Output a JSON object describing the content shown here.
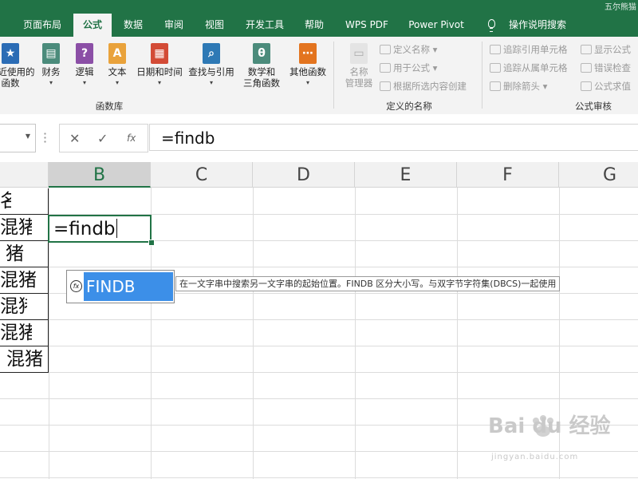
{
  "tabs": [
    "页面布局",
    "公式",
    "数据",
    "审阅",
    "视图",
    "开发工具",
    "帮助",
    "WPS PDF",
    "Power Pivot",
    "操作说明搜索"
  ],
  "title_fragment": "五尔熊猫",
  "ribbon": {
    "function_library": {
      "label": "函数库",
      "buttons": [
        {
          "label": "最近使用的\n函数",
          "icon": "star-icon",
          "color": "#2b6cb5"
        },
        {
          "label": "财务",
          "icon": "coins-icon",
          "color": "#4b8b7b"
        },
        {
          "label": "逻辑",
          "icon": "question-icon",
          "color": "#8b4fa6"
        },
        {
          "label": "文本",
          "icon": "text-a-icon",
          "color": "#e9a23b"
        },
        {
          "label": "日期和时间",
          "icon": "calendar-icon",
          "color": "#d34b36"
        },
        {
          "label": "查找与引用",
          "icon": "magnifier-icon",
          "color": "#2e79b5"
        },
        {
          "label": "数学和\n三角函数",
          "icon": "theta-icon",
          "color": "#4b8b7b"
        },
        {
          "label": "其他函数",
          "icon": "more-icon",
          "color": "#e3741f"
        }
      ]
    },
    "defined_names": {
      "label": "定义的名称",
      "name_manager": "名称\n管理器",
      "items": [
        "定义名称",
        "用于公式",
        "根据所选内容创建"
      ]
    },
    "formula_auditing": {
      "label": "公式审核",
      "items_left": [
        "追踪引用单元格",
        "追踪从属单元格",
        "删除箭头"
      ],
      "items_right": [
        "显示公式",
        "错误检查",
        "公式求值"
      ]
    }
  },
  "formula_bar": {
    "cancel": "✕",
    "enter": "✓",
    "fx": "fx",
    "content": "=findb"
  },
  "columns": [
    "B",
    "C",
    "D",
    "E",
    "F",
    "G"
  ],
  "column_a_cells": [
    "名",
    "混猪",
    "猪",
    "混猪",
    "混猪",
    "混猪",
    "混猪"
  ],
  "active_cell": {
    "text": "=findb"
  },
  "autocomplete": {
    "icon": "fx",
    "item": "FINDB",
    "tooltip": "在一文字串中搜索另一文字串的起始位置。FINDB 区分大小写。与双字节字符集(DBCS)一起使用"
  },
  "watermark": {
    "main": "Bai du 经验",
    "sub": "jingyan.baidu.com"
  }
}
